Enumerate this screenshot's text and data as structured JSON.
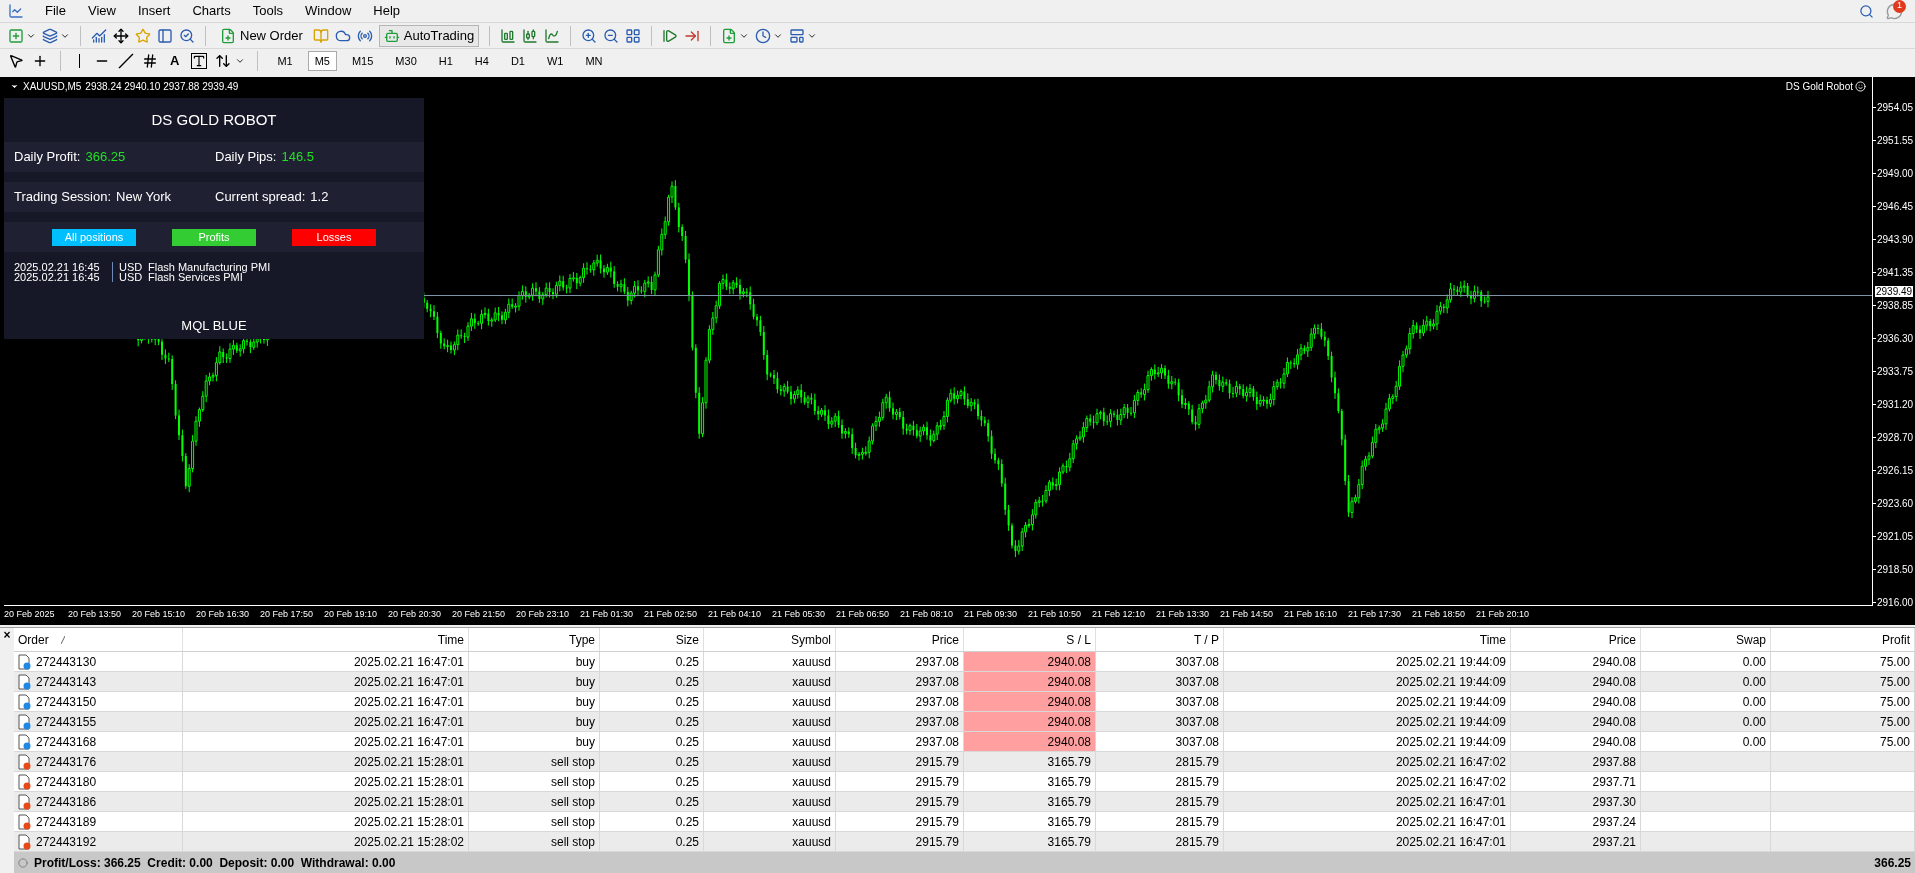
{
  "menu": [
    "File",
    "View",
    "Insert",
    "Charts",
    "Tools",
    "Window",
    "Help"
  ],
  "toolbar": {
    "new_order": "New Order",
    "auto_trading": "AutoTrading",
    "text_tool": "A",
    "timeframes": [
      {
        "label": "M1",
        "selected": false
      },
      {
        "label": "M5",
        "selected": true
      },
      {
        "label": "M15",
        "selected": false
      },
      {
        "label": "M30",
        "selected": false
      },
      {
        "label": "H1",
        "selected": false
      },
      {
        "label": "H4",
        "selected": false
      },
      {
        "label": "D1",
        "selected": false
      },
      {
        "label": "W1",
        "selected": false
      },
      {
        "label": "MN",
        "selected": false
      }
    ]
  },
  "notifications": {
    "badge": "1"
  },
  "chart": {
    "symbol": "XAUUSD,M5",
    "ohlc": "2938.24 2940.10 2937.88 2939.49",
    "expert": "DS Gold Robot",
    "current_price": "2939.49",
    "price_ticks": [
      "2954.05",
      "2951.55",
      "2949.00",
      "2946.45",
      "2943.90",
      "2941.35",
      "2938.85",
      "2936.30",
      "2933.75",
      "2931.20",
      "2928.70",
      "2926.15",
      "2923.60",
      "2921.05",
      "2918.50",
      "2916.00"
    ],
    "time_ticks": [
      "20 Feb 2025",
      "20 Feb 13:50",
      "20 Feb 15:10",
      "20 Feb 16:30",
      "20 Feb 17:50",
      "20 Feb 19:10",
      "20 Feb 20:30",
      "20 Feb 21:50",
      "20 Feb 23:10",
      "21 Feb 01:30",
      "21 Feb 02:50",
      "21 Feb 04:10",
      "21 Feb 05:30",
      "21 Feb 06:50",
      "21 Feb 08:10",
      "21 Feb 09:30",
      "21 Feb 10:50",
      "21 Feb 12:10",
      "21 Feb 13:30",
      "21 Feb 14:50",
      "21 Feb 16:10",
      "21 Feb 17:30",
      "21 Feb 18:50",
      "21 Feb 20:10"
    ]
  },
  "robot_panel": {
    "title": "DS GOLD ROBOT",
    "stats": [
      {
        "label": "Daily Profit:",
        "value": "366.25",
        "positive": true
      },
      {
        "label": "Daily Pips:",
        "value": "146.5",
        "positive": true
      },
      {
        "label": "Trading Session:",
        "value": "New York",
        "positive": false
      },
      {
        "label": "Current spread:",
        "value": "1.2",
        "positive": false
      }
    ],
    "filters": [
      {
        "label": "All positions",
        "color": "#00bfff"
      },
      {
        "label": "Profits",
        "color": "#33cc33"
      },
      {
        "label": "Losses",
        "color": "#ff0000"
      }
    ],
    "news": [
      {
        "time": "2025.02.21 16:45",
        "currency": "USD",
        "event": "Flash Manufacturing PMI"
      },
      {
        "time": "2025.02.21 16:45",
        "currency": "USD",
        "event": "Flash Services PMI"
      }
    ],
    "footer": "MQL BLUE"
  },
  "terminal": {
    "close": "×",
    "columns": [
      "Order",
      "Time",
      "Type",
      "Size",
      "Symbol",
      "Price",
      "S / L",
      "T / P",
      "Time",
      "Price",
      "Swap",
      "Profit"
    ],
    "rows": [
      {
        "kind": "buy",
        "sl_highlight": true,
        "cells": [
          "272443130",
          "2025.02.21 16:47:01",
          "buy",
          "0.25",
          "xauusd",
          "2937.08",
          "2940.08",
          "3037.08",
          "2025.02.21 19:44:09",
          "2940.08",
          "0.00",
          "75.00"
        ]
      },
      {
        "kind": "buy",
        "sl_highlight": true,
        "cells": [
          "272443143",
          "2025.02.21 16:47:01",
          "buy",
          "0.25",
          "xauusd",
          "2937.08",
          "2940.08",
          "3037.08",
          "2025.02.21 19:44:09",
          "2940.08",
          "0.00",
          "75.00"
        ]
      },
      {
        "kind": "buy",
        "sl_highlight": true,
        "cells": [
          "272443150",
          "2025.02.21 16:47:01",
          "buy",
          "0.25",
          "xauusd",
          "2937.08",
          "2940.08",
          "3037.08",
          "2025.02.21 19:44:09",
          "2940.08",
          "0.00",
          "75.00"
        ]
      },
      {
        "kind": "buy",
        "sl_highlight": true,
        "cells": [
          "272443155",
          "2025.02.21 16:47:01",
          "buy",
          "0.25",
          "xauusd",
          "2937.08",
          "2940.08",
          "3037.08",
          "2025.02.21 19:44:09",
          "2940.08",
          "0.00",
          "75.00"
        ]
      },
      {
        "kind": "buy",
        "sl_highlight": true,
        "cells": [
          "272443168",
          "2025.02.21 16:47:01",
          "buy",
          "0.25",
          "xauusd",
          "2937.08",
          "2940.08",
          "3037.08",
          "2025.02.21 19:44:09",
          "2940.08",
          "0.00",
          "75.00"
        ]
      },
      {
        "kind": "pending",
        "sl_highlight": false,
        "cells": [
          "272443176",
          "2025.02.21 15:28:01",
          "sell stop",
          "0.25",
          "xauusd",
          "2915.79",
          "3165.79",
          "2815.79",
          "2025.02.21 16:47:02",
          "2937.88"
        ]
      },
      {
        "kind": "pending",
        "sl_highlight": false,
        "cells": [
          "272443180",
          "2025.02.21 15:28:01",
          "sell stop",
          "0.25",
          "xauusd",
          "2915.79",
          "3165.79",
          "2815.79",
          "2025.02.21 16:47:02",
          "2937.71"
        ]
      },
      {
        "kind": "pending",
        "sl_highlight": false,
        "cells": [
          "272443186",
          "2025.02.21 15:28:01",
          "sell stop",
          "0.25",
          "xauusd",
          "2915.79",
          "3165.79",
          "2815.79",
          "2025.02.21 16:47:01",
          "2937.30"
        ]
      },
      {
        "kind": "pending",
        "sl_highlight": false,
        "cells": [
          "272443189",
          "2025.02.21 15:28:01",
          "sell stop",
          "0.25",
          "xauusd",
          "2915.79",
          "3165.79",
          "2815.79",
          "2025.02.21 16:47:01",
          "2937.24"
        ]
      },
      {
        "kind": "pending",
        "sl_highlight": false,
        "cells": [
          "272443192",
          "2025.02.21 15:28:02",
          "sell stop",
          "0.25",
          "xauusd",
          "2915.79",
          "3165.79",
          "2815.79",
          "2025.02.21 16:47:01",
          "2937.21"
        ]
      }
    ],
    "status": "Profit/Loss: 366.25  Credit: 0.00  Deposit: 0.00  Withdrawal: 0.00",
    "total": "366.25"
  }
}
